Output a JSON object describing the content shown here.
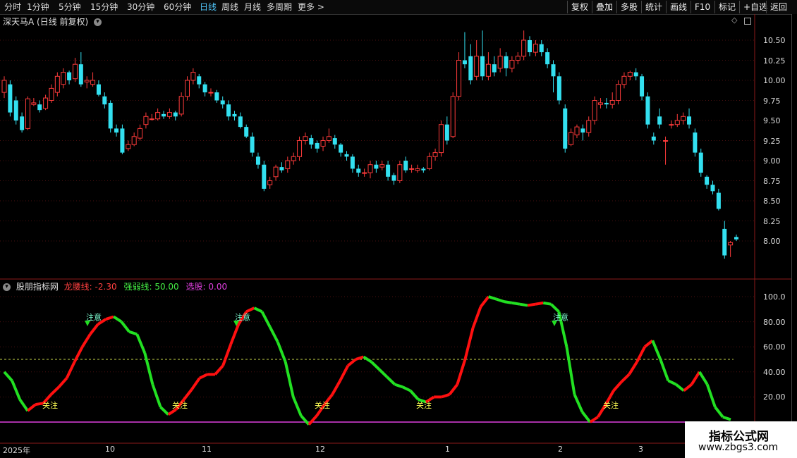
{
  "toolbar": {
    "periods": [
      "分时",
      "1分钟",
      "5分钟",
      "15分钟",
      "30分钟",
      "60分钟",
      "日线",
      "周线",
      "月线",
      "多周期",
      "更多"
    ],
    "active_period": "日线",
    "right_buttons": [
      "复权",
      "叠加",
      "多股",
      "统计",
      "画线",
      "F10",
      "标记",
      "+自选",
      "返回"
    ]
  },
  "stock": {
    "name": "深天马A",
    "mode": "(日线 前复权)"
  },
  "price_axis": [
    "10.50",
    "10.25",
    "10.00",
    "9.75",
    "9.50",
    "9.25",
    "9.00",
    "8.75",
    "8.50",
    "8.25",
    "8.00"
  ],
  "indicator": {
    "name": "股朋指标网",
    "longyao_label": "龙腰线:",
    "longyao_value": "-2.30",
    "qiangruo_label": "强弱线:",
    "qiangruo_value": "50.00",
    "xuangu_label": "选股:",
    "xuangu_value": "0.00",
    "axis": [
      "100.0",
      "80.00",
      "60.00",
      "40.00",
      "20.00"
    ]
  },
  "dates": [
    "2025年",
    "10",
    "11",
    "12",
    "1",
    "2",
    "3"
  ],
  "annotations": {
    "zhuyi": "注意",
    "guanzhu": "关注"
  },
  "watermark": {
    "line1": "指标公式网",
    "line2": "www.zbgs3.com"
  },
  "colors": {
    "up": "#ff3b3b",
    "down": "#33e0f0",
    "ind_up": "#ff1010",
    "ind_down": "#22e022",
    "magenta": "#e040e0",
    "dashed": "#c8d84a"
  },
  "chart_data": {
    "type": "candlestick",
    "candles": [
      [
        9.85,
        10.0,
        10.05,
        9.78
      ],
      [
        9.95,
        9.6,
        10.0,
        9.55
      ],
      [
        9.75,
        9.5,
        9.8,
        9.45
      ],
      [
        9.55,
        9.38,
        9.6,
        9.35
      ],
      [
        9.4,
        9.77,
        9.8,
        9.38
      ],
      [
        9.7,
        9.72,
        9.78,
        9.68
      ],
      [
        9.7,
        9.63,
        9.75,
        9.6
      ],
      [
        9.65,
        9.78,
        9.82,
        9.63
      ],
      [
        9.75,
        9.9,
        9.95,
        9.72
      ],
      [
        9.85,
        10.05,
        10.1,
        9.8
      ],
      [
        9.95,
        10.1,
        10.15,
        9.9
      ],
      [
        10.1,
        10.0,
        10.12,
        9.95
      ],
      [
        10.02,
        10.2,
        10.28,
        9.98
      ],
      [
        10.2,
        9.95,
        10.35,
        9.92
      ],
      [
        9.98,
        10.0,
        10.05,
        9.9
      ],
      [
        9.95,
        10.0,
        10.1,
        9.92
      ],
      [
        9.95,
        9.82,
        10.0,
        9.8
      ],
      [
        9.8,
        9.7,
        9.85,
        9.65
      ],
      [
        9.72,
        9.4,
        9.75,
        9.35
      ],
      [
        9.4,
        9.35,
        9.45,
        9.3
      ],
      [
        9.4,
        9.1,
        9.45,
        9.08
      ],
      [
        9.15,
        9.2,
        9.25,
        9.12
      ],
      [
        9.2,
        9.3,
        9.35,
        9.18
      ],
      [
        9.28,
        9.4,
        9.45,
        9.25
      ],
      [
        9.45,
        9.55,
        9.6,
        9.4
      ],
      [
        9.52,
        9.52,
        9.58,
        9.5
      ],
      [
        9.52,
        9.6,
        9.65,
        9.5
      ],
      [
        9.58,
        9.55,
        9.62,
        9.52
      ],
      [
        9.55,
        9.6,
        9.65,
        9.52
      ],
      [
        9.6,
        9.55,
        9.62,
        9.5
      ],
      [
        9.58,
        9.8,
        9.85,
        9.55
      ],
      [
        9.8,
        10.0,
        10.05,
        9.75
      ],
      [
        10.0,
        10.1,
        10.15,
        9.95
      ],
      [
        10.05,
        9.95,
        10.08,
        9.9
      ],
      [
        9.95,
        9.85,
        9.98,
        9.8
      ],
      [
        9.85,
        9.85,
        9.9,
        9.8
      ],
      [
        9.85,
        9.75,
        9.88,
        9.72
      ],
      [
        9.75,
        9.7,
        9.8,
        9.65
      ],
      [
        9.7,
        9.55,
        9.75,
        9.5
      ],
      [
        9.58,
        9.55,
        9.62,
        9.5
      ],
      [
        9.55,
        9.42,
        9.6,
        9.4
      ],
      [
        9.42,
        9.3,
        9.45,
        9.28
      ],
      [
        9.3,
        9.1,
        9.35,
        9.05
      ],
      [
        9.05,
        8.95,
        9.1,
        8.9
      ],
      [
        8.95,
        8.65,
        9.0,
        8.62
      ],
      [
        8.7,
        8.75,
        8.8,
        8.65
      ],
      [
        8.8,
        8.92,
        8.95,
        8.75
      ],
      [
        8.92,
        8.88,
        8.98,
        8.85
      ],
      [
        8.9,
        9.0,
        9.05,
        8.85
      ],
      [
        9.0,
        9.05,
        9.1,
        8.95
      ],
      [
        9.05,
        9.25,
        9.3,
        9.0
      ],
      [
        9.25,
        9.3,
        9.35,
        9.2
      ],
      [
        9.28,
        9.2,
        9.32,
        9.15
      ],
      [
        9.22,
        9.15,
        9.25,
        9.1
      ],
      [
        9.18,
        9.25,
        9.3,
        9.12
      ],
      [
        9.25,
        9.3,
        9.4,
        9.22
      ],
      [
        9.28,
        9.2,
        9.32,
        9.15
      ],
      [
        9.2,
        9.1,
        9.22,
        9.05
      ],
      [
        9.08,
        9.05,
        9.12,
        9.0
      ],
      [
        9.05,
        8.9,
        9.08,
        8.85
      ],
      [
        8.9,
        8.85,
        8.95,
        8.8
      ],
      [
        8.85,
        8.85,
        8.9,
        8.8
      ],
      [
        8.85,
        8.95,
        9.0,
        8.78
      ],
      [
        8.95,
        8.9,
        9.0,
        8.85
      ],
      [
        8.92,
        8.95,
        9.0,
        8.88
      ],
      [
        8.95,
        8.8,
        9.0,
        8.75
      ],
      [
        8.82,
        8.75,
        8.85,
        8.7
      ],
      [
        8.75,
        8.95,
        9.0,
        8.72
      ],
      [
        9.0,
        8.88,
        9.05,
        8.85
      ],
      [
        8.9,
        8.9,
        8.95,
        8.85
      ],
      [
        8.88,
        8.9,
        8.95,
        8.85
      ],
      [
        8.9,
        8.88,
        8.92,
        8.85
      ],
      [
        8.9,
        9.05,
        9.1,
        8.88
      ],
      [
        9.05,
        9.1,
        9.15,
        9.0
      ],
      [
        9.1,
        9.45,
        9.5,
        9.05
      ],
      [
        9.45,
        9.25,
        9.55,
        9.2
      ],
      [
        9.3,
        9.8,
        9.85,
        9.28
      ],
      [
        9.8,
        10.25,
        10.35,
        9.75
      ],
      [
        10.25,
        10.2,
        10.6,
        10.15
      ],
      [
        10.3,
        10.0,
        10.45,
        9.95
      ],
      [
        10.05,
        10.3,
        10.5,
        10.0
      ],
      [
        10.3,
        10.05,
        10.62,
        10.0
      ],
      [
        10.05,
        10.2,
        10.35,
        10.0
      ],
      [
        10.2,
        10.1,
        10.3,
        10.05
      ],
      [
        10.15,
        10.3,
        10.4,
        10.1
      ],
      [
        10.3,
        10.15,
        10.35,
        10.05
      ],
      [
        10.15,
        10.25,
        10.3,
        10.1
      ],
      [
        10.25,
        10.3,
        10.35,
        10.2
      ],
      [
        10.3,
        10.5,
        10.62,
        10.25
      ],
      [
        10.5,
        10.35,
        10.55,
        10.3
      ],
      [
        10.35,
        10.45,
        10.5,
        10.3
      ],
      [
        10.45,
        10.35,
        10.5,
        10.3
      ],
      [
        10.35,
        10.2,
        10.4,
        10.15
      ],
      [
        10.2,
        10.05,
        10.25,
        9.85
      ],
      [
        10.05,
        9.75,
        10.1,
        9.7
      ],
      [
        9.65,
        9.15,
        9.7,
        9.1
      ],
      [
        9.2,
        9.35,
        9.4,
        9.18
      ],
      [
        9.32,
        9.42,
        9.45,
        9.28
      ],
      [
        9.4,
        9.35,
        9.45,
        9.25
      ],
      [
        9.35,
        9.5,
        9.55,
        9.3
      ],
      [
        9.5,
        9.75,
        9.8,
        9.45
      ],
      [
        9.7,
        9.72,
        9.78,
        9.65
      ],
      [
        9.72,
        9.7,
        9.78,
        9.65
      ],
      [
        9.7,
        9.75,
        9.85,
        9.65
      ],
      [
        9.75,
        9.95,
        10.0,
        9.7
      ],
      [
        9.95,
        10.05,
        10.1,
        9.9
      ],
      [
        10.05,
        10.1,
        10.12,
        10.0
      ],
      [
        10.1,
        10.05,
        10.15,
        10.0
      ],
      [
        10.05,
        9.8,
        10.08,
        9.75
      ],
      [
        9.8,
        9.45,
        9.85,
        9.4
      ],
      [
        9.3,
        9.25,
        9.35,
        9.2
      ],
      [
        9.55,
        9.45,
        9.65,
        9.4
      ],
      [
        9.25,
        9.25,
        9.3,
        8.95
      ],
      [
        9.45,
        9.45,
        9.5,
        9.4
      ],
      [
        9.45,
        9.5,
        9.58,
        9.42
      ],
      [
        9.5,
        9.55,
        9.6,
        9.45
      ],
      [
        9.55,
        9.45,
        9.65,
        9.4
      ],
      [
        9.35,
        9.1,
        9.4,
        9.05
      ],
      [
        9.1,
        8.85,
        9.15,
        8.8
      ],
      [
        8.8,
        8.7,
        8.82,
        8.65
      ],
      [
        8.7,
        8.62,
        8.75,
        8.58
      ],
      [
        8.6,
        8.4,
        8.65,
        8.38
      ],
      [
        8.15,
        7.82,
        8.25,
        7.78
      ],
      [
        7.95,
        7.98,
        8.0,
        7.8
      ],
      [
        8.05,
        8.02,
        8.08,
        8.0
      ]
    ],
    "ind_series": [
      40,
      33,
      18,
      9,
      14,
      15,
      22,
      28,
      35,
      48,
      60,
      70,
      78,
      82,
      84,
      80,
      72,
      70,
      55,
      30,
      12,
      6,
      10,
      18,
      26,
      35,
      38,
      38,
      45,
      62,
      78,
      88,
      91,
      88,
      76,
      64,
      48,
      20,
      5,
      -2,
      5,
      14,
      22,
      33,
      45,
      50,
      52,
      48,
      42,
      36,
      30,
      28,
      25,
      18,
      16,
      20,
      20,
      22,
      30,
      50,
      75,
      92,
      100,
      98,
      96,
      95,
      94,
      93,
      94,
      95,
      94,
      88,
      60,
      22,
      8,
      0,
      4,
      14,
      25,
      32,
      38,
      48,
      60,
      65,
      50,
      33,
      30,
      25,
      30,
      40,
      30,
      12,
      4,
      2
    ]
  }
}
